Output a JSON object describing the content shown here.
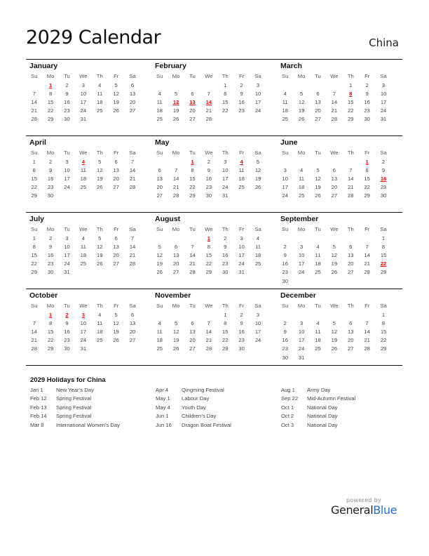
{
  "header": {
    "title": "2029 Calendar",
    "country": "China"
  },
  "weekdays": [
    "Su",
    "Mo",
    "Tu",
    "We",
    "Th",
    "Fr",
    "Sa"
  ],
  "colors": {
    "holiday": "#e00000",
    "brand_blue": "#2a6fbb"
  },
  "months": [
    {
      "name": "January",
      "start": 1,
      "days": 31,
      "holidays": [
        1
      ]
    },
    {
      "name": "February",
      "start": 4,
      "days": 28,
      "holidays": [
        12,
        13,
        14
      ]
    },
    {
      "name": "March",
      "start": 4,
      "days": 31,
      "holidays": [
        8
      ]
    },
    {
      "name": "April",
      "start": 0,
      "days": 30,
      "holidays": [
        4
      ]
    },
    {
      "name": "May",
      "start": 2,
      "days": 31,
      "holidays": [
        1,
        4
      ]
    },
    {
      "name": "June",
      "start": 5,
      "days": 30,
      "holidays": [
        1,
        16
      ]
    },
    {
      "name": "July",
      "start": 0,
      "days": 31,
      "holidays": []
    },
    {
      "name": "August",
      "start": 3,
      "days": 31,
      "holidays": [
        1
      ]
    },
    {
      "name": "September",
      "start": 6,
      "days": 30,
      "holidays": [
        22
      ]
    },
    {
      "name": "October",
      "start": 1,
      "days": 31,
      "holidays": [
        1,
        2,
        3
      ]
    },
    {
      "name": "November",
      "start": 4,
      "days": 30,
      "holidays": []
    },
    {
      "name": "December",
      "start": 6,
      "days": 31,
      "holidays": []
    }
  ],
  "holidays_section": {
    "title": "2029 Holidays for China",
    "columns": [
      [
        {
          "date": "Jan 1",
          "name": "New Year’s Day"
        },
        {
          "date": "Feb 12",
          "name": "Spring Festival"
        },
        {
          "date": "Feb 13",
          "name": "Spring Festival"
        },
        {
          "date": "Feb 14",
          "name": "Spring Festival"
        },
        {
          "date": "Mar 8",
          "name": "International Women’s Day"
        }
      ],
      [
        {
          "date": "Apr 4",
          "name": "Qingming Festival"
        },
        {
          "date": "May 1",
          "name": "Labour Day"
        },
        {
          "date": "May 4",
          "name": "Youth Day"
        },
        {
          "date": "Jun 1",
          "name": "Children’s Day"
        },
        {
          "date": "Jun 16",
          "name": "Dragon Boat Festival"
        }
      ],
      [
        {
          "date": "Aug 1",
          "name": "Army Day"
        },
        {
          "date": "Sep 22",
          "name": "Mid-Autumn Festival"
        },
        {
          "date": "Oct 1",
          "name": "National Day"
        },
        {
          "date": "Oct 2",
          "name": "National Day"
        },
        {
          "date": "Oct 3",
          "name": "National Day"
        }
      ]
    ]
  },
  "footer": {
    "powered_by": "powered by",
    "brand_part1": "General",
    "brand_part2": "Blue"
  }
}
